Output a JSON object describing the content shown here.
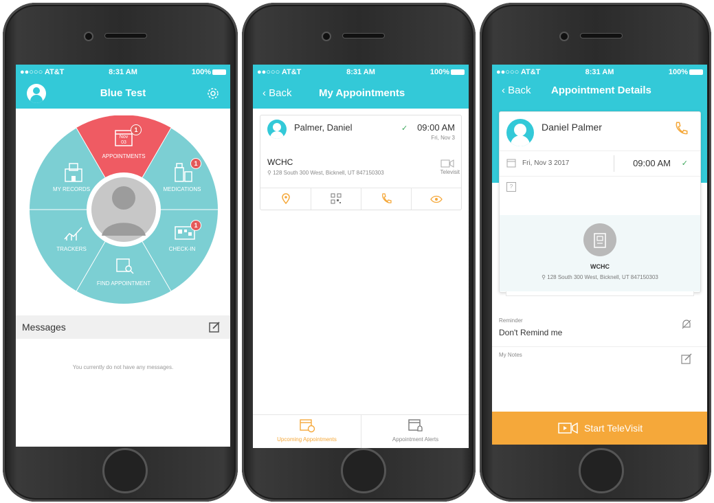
{
  "colors": {
    "teal": "#33c9d8",
    "red": "#ef5b63",
    "orange": "#f5a83a",
    "check": "#3aa65a"
  },
  "status": {
    "carrier": "●●○○○ AT&T",
    "time": "8:31 AM",
    "battery": "100%"
  },
  "home": {
    "title": "Blue Test",
    "segments": {
      "appointments": "APPOINTMENTS",
      "medications": "MEDICATIONS",
      "check_in": "CHECK-IN",
      "find_appointment": "FIND APPOINTMENT",
      "trackers": "TRACKERS",
      "my_records": "MY RECORDS"
    },
    "calendar_month": "Nov",
    "calendar_day": "03",
    "badges": {
      "appointments": "1",
      "medications": "1",
      "check_in": "1"
    },
    "messages_title": "Messages",
    "empty_text": "You currently do not have any messages."
  },
  "list": {
    "back": "Back",
    "title": "My Appointments",
    "card": {
      "name": "Palmer, Daniel",
      "time": "09:00 AM",
      "date": "Fri, Nov 3",
      "location": "WCHC",
      "address": "128 South 300 West, Bicknell, UT 847150303",
      "televisit": "Televisit"
    },
    "tabs": {
      "upcoming": "Upcoming Appointments",
      "alerts": "Appointment Alerts"
    }
  },
  "details": {
    "back": "Back",
    "title": "Appointment Details",
    "name": "Daniel Palmer",
    "date": "Fri, Nov 3  2017",
    "time": "09:00 AM",
    "question": "?",
    "facility": "WCHC",
    "address": "128 South 300 West, Bicknell, UT 847150303",
    "reminder_label": "Reminder",
    "reminder_value": "Don't Remind me",
    "notes_label": "My Notes",
    "start": "Start TeleVisit"
  }
}
